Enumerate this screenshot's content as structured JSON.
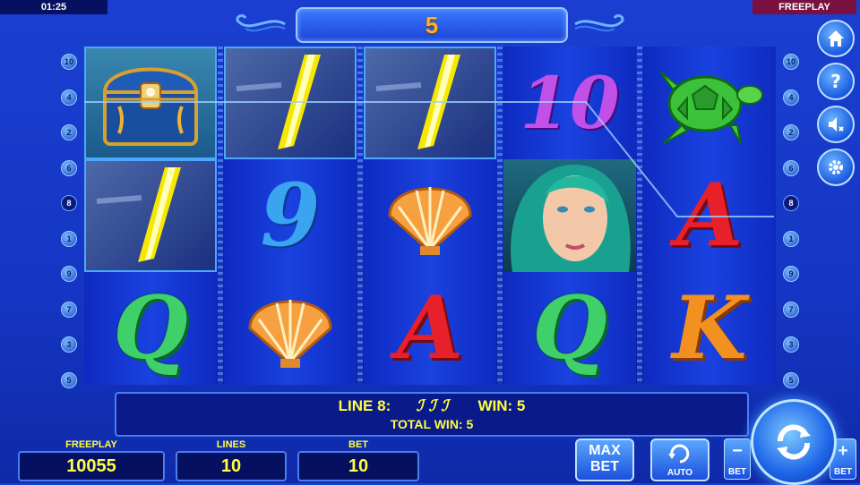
{
  "status": {
    "clock": "01:25",
    "mode": "FREEPLAY"
  },
  "header": {
    "free_spins_count": "5"
  },
  "reels": {
    "symbols": [
      [
        "treasure-chest",
        "lightning-wild",
        "letter-Q"
      ],
      [
        "lightning-wild",
        "nine",
        "scallop-shell"
      ],
      [
        "lightning-wild",
        "scallop-shell",
        "letter-A"
      ],
      [
        "ten",
        "mermaid",
        "letter-Q"
      ],
      [
        "sea-turtle",
        "letter-A",
        "letter-K"
      ]
    ],
    "texts": {
      "nine": "9",
      "ten": "10",
      "A": "A",
      "Q": "Q",
      "K": "K"
    }
  },
  "paylines": {
    "left": [
      "10",
      "4",
      "2",
      "6",
      "8",
      "1",
      "9",
      "7",
      "3",
      "5"
    ],
    "right": [
      "10",
      "4",
      "2",
      "6",
      "8",
      "1",
      "9",
      "7",
      "3",
      "5"
    ],
    "active": "8"
  },
  "win_panel": {
    "line_text": "LINE 8:",
    "line_symbols": "ℐ ℐ ℐ",
    "win_text": "WIN: 5",
    "total_text": "TOTAL WIN: 5"
  },
  "bottom": {
    "freeplay_label": "FREEPLAY",
    "freeplay_value": "10055",
    "lines_label": "LINES",
    "lines_value": "10",
    "bet_label": "BET",
    "bet_value": "10",
    "maxbet_line1": "MAX",
    "maxbet_line2": "BET",
    "auto_label": "AUTO",
    "minus_sign": "−",
    "minus_caption": "BET",
    "plus_sign": "+",
    "plus_caption": "BET"
  },
  "side_menu": [
    "home-icon",
    "help-icon",
    "sound-off-icon",
    "settings-icon"
  ],
  "colors": {
    "accent_yellow": "#ffff40",
    "title_number": "#ffb020",
    "panel_dark": "#061060",
    "background_blue": "#1536c4"
  }
}
